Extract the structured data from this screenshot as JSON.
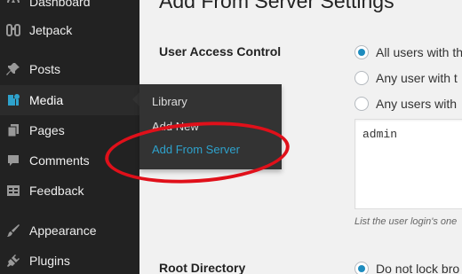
{
  "sidebar": {
    "items": [
      {
        "label": "Dashboard",
        "icon": "dashboard-icon"
      },
      {
        "label": "Jetpack",
        "icon": "jetpack-icon"
      },
      {
        "label": "Posts",
        "icon": "pin-icon"
      },
      {
        "label": "Media",
        "icon": "media-icon"
      },
      {
        "label": "Pages",
        "icon": "pages-icon"
      },
      {
        "label": "Comments",
        "icon": "comments-icon"
      },
      {
        "label": "Feedback",
        "icon": "feedback-icon"
      },
      {
        "label": "Appearance",
        "icon": "brush-icon"
      },
      {
        "label": "Plugins",
        "icon": "plugins-icon"
      }
    ],
    "active": "Media"
  },
  "flyout": {
    "items": [
      {
        "label": "Library"
      },
      {
        "label": "Add New"
      },
      {
        "label": "Add From Server"
      }
    ],
    "current": "Add From Server"
  },
  "main": {
    "title": "Add From Server Settings",
    "user_access": {
      "label": "User Access Control",
      "options": [
        {
          "label": "All users with th",
          "checked": true
        },
        {
          "label": "Any user with t",
          "checked": false
        },
        {
          "label": "Any users with",
          "checked": false
        }
      ],
      "textarea_value": "admin",
      "help": "List the user login's one"
    },
    "root_directory": {
      "label": "Root Directory",
      "options": [
        {
          "label": "Do not lock bro",
          "checked": true
        }
      ]
    }
  },
  "colors": {
    "sidebar_bg": "#222222",
    "flyout_bg": "#333333",
    "accent": "#2ea2cc",
    "annotation": "#e0101a"
  }
}
